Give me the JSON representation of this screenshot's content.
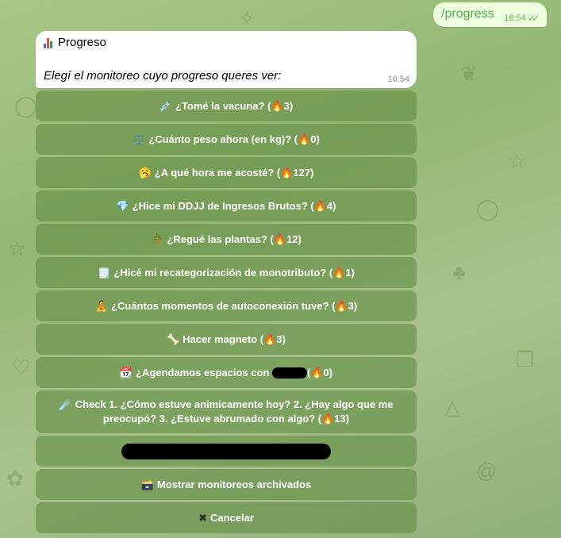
{
  "chat": {
    "outgoing": {
      "text": "/progress",
      "time": "16:54",
      "status_icon": "double-check-icon"
    },
    "incoming": {
      "title_icon": "bar-chart-icon",
      "title": "Progreso",
      "body": "Elegí el monitoreo cuyo progreso queres ver:",
      "time": "16:54"
    }
  },
  "keyboard": {
    "buttons": [
      {
        "emoji": "💉",
        "pre": "¿Tomé la vacuna? (",
        "fire": "🔥",
        "count": "3",
        "post": ")"
      },
      {
        "emoji": "⚖️",
        "pre": "¿Cuánto peso ahora (en kg)? (",
        "fire": "🔥",
        "count": "0",
        "post": ")"
      },
      {
        "emoji": "🥱",
        "pre": "¿A qué hora me acosté? (",
        "fire": "🔥",
        "count": "127",
        "post": ")"
      },
      {
        "emoji": "💎",
        "pre": "¿Hice mi DDJJ de Ingresos Brutos? (",
        "fire": "🔥",
        "count": "4",
        "post": ")"
      },
      {
        "emoji": "🌴",
        "pre": "¿Regué las plantas? (",
        "fire": "🔥",
        "count": "12",
        "post": ")"
      },
      {
        "emoji": "🗒️",
        "pre": "¿Hicé mi recategorización de monotributo? (",
        "fire": "🔥",
        "count": "1",
        "post": ")"
      },
      {
        "emoji": "🧘",
        "pre": "¿Cuántos momentos de autoconexión tuve? (",
        "fire": "🔥",
        "count": "3",
        "post": ")"
      },
      {
        "emoji": "🦴",
        "pre": "Hacer magneto (",
        "fire": "🔥",
        "count": "3",
        "post": ")"
      },
      {
        "emoji": "📆",
        "pre": "¿Agendamos espacios con ",
        "fire": "🔥",
        "count": "0",
        "post": ")"
      },
      {
        "emoji": "☄️",
        "line1": "Check 1. ¿Cómo estuve animicamente hoy? 2. ¿Hay algo que me",
        "line2_pre": "preocupó? 3. ¿Estuve abrumado con algo? (",
        "fire": "🔥",
        "count": "13",
        "post": ")"
      },
      {
        "redacted": true
      },
      {
        "emoji": "🗃️",
        "label": "Mostrar monitoreos archivados"
      },
      {
        "emoji": "✖",
        "label": "Cancelar"
      }
    ]
  },
  "colors": {
    "outgoing_bubble": "#eeffde",
    "outgoing_text": "#4fae4e",
    "keyboard_button": "#6b8c4a",
    "background": "#9fc27f"
  }
}
